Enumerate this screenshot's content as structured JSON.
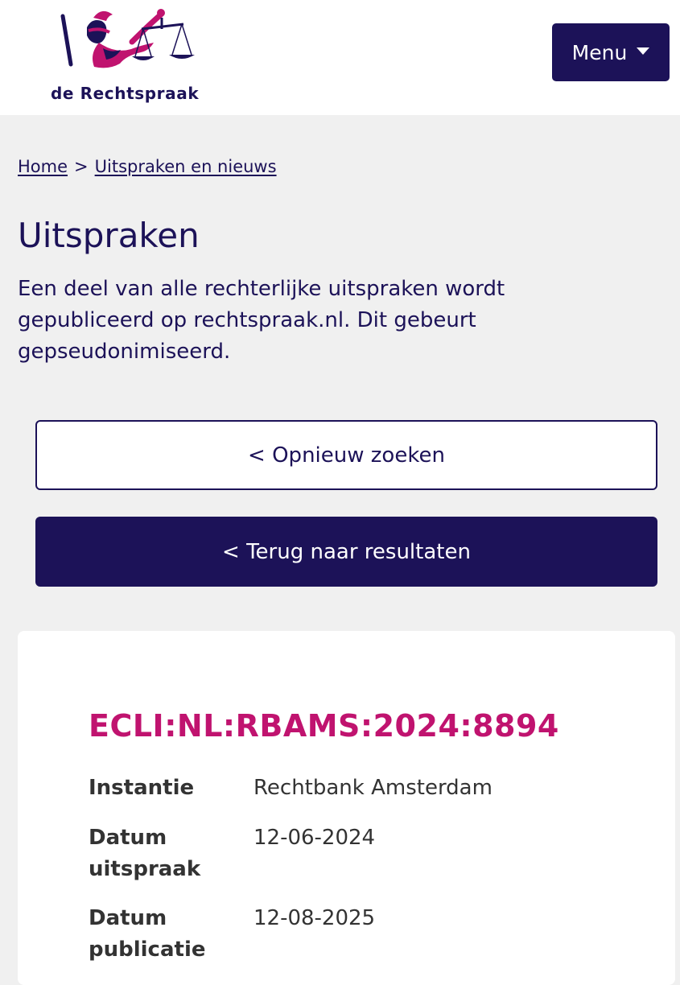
{
  "header": {
    "logo_text": "de Rechtspraak",
    "menu_label": "Menu"
  },
  "breadcrumb": {
    "items": [
      "Home",
      "Uitspraken en nieuws"
    ],
    "separator": ">"
  },
  "page": {
    "title": "Uitspraken",
    "intro": "Een deel van alle rechterlijke uitspraken wordt gepubliceerd op rechtspraak.nl. Dit gebeurt gepseudonimiseerd."
  },
  "actions": {
    "search_again": "< Opnieuw zoeken",
    "back_to_results": "< Terug naar resultaten"
  },
  "ruling": {
    "ecli": "ECLI:NL:RBAMS:2024:8894",
    "fields": [
      {
        "label": "Instantie",
        "value": "Rechtbank Amsterdam"
      },
      {
        "label": "Datum uitspraak",
        "value": "12-06-2024"
      },
      {
        "label": "Datum publicatie",
        "value": "12-08-2025"
      }
    ]
  },
  "colors": {
    "brand_navy": "#1c1258",
    "ecli_magenta": "#c0136f",
    "background": "#f0f0f0"
  }
}
